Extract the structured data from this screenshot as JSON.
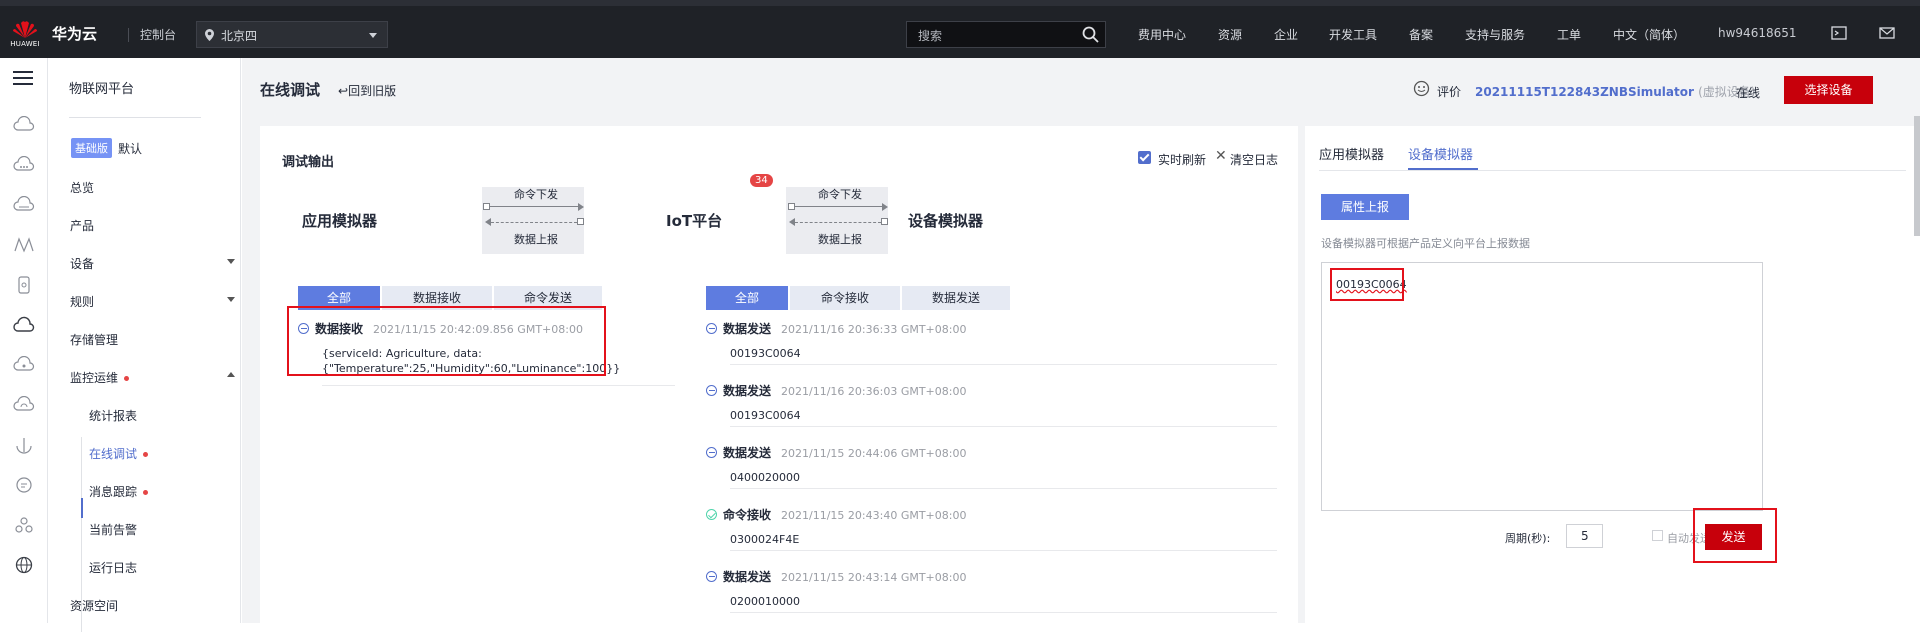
{
  "topbar": {
    "logo_small": "HUAWEI",
    "brand": "华为云",
    "console": "控制台",
    "region": "北京四",
    "search_placeholder": "搜索",
    "nav": [
      "费用中心",
      "资源",
      "企业",
      "开发工具",
      "备案",
      "支持与服务",
      "工单",
      "中文（简体）",
      "hw94618651"
    ]
  },
  "sidebar": {
    "title": "物联网平台",
    "edition_badge": "基础版",
    "edition_default": "默认",
    "items": [
      {
        "label": "总览"
      },
      {
        "label": "产品"
      },
      {
        "label": "设备"
      },
      {
        "label": "规则"
      },
      {
        "label": "存储管理"
      },
      {
        "label": "监控运维"
      }
    ],
    "subitems": [
      {
        "label": "统计报表"
      },
      {
        "label": "在线调试"
      },
      {
        "label": "消息跟踪"
      },
      {
        "label": "当前告警"
      },
      {
        "label": "运行日志"
      }
    ],
    "bottom_item": "资源空间"
  },
  "page": {
    "title": "在线调试",
    "back_link": "回到旧版",
    "rate": "评价",
    "device_name": "20211115T122843ZNBSimulator",
    "device_tag": "(虚拟设备)",
    "status": "在线",
    "select_device": "选择设备"
  },
  "debug": {
    "title": "调试输出",
    "realtime": "实时刷新",
    "clear": "清空日志",
    "flow": {
      "app": "应用模拟器",
      "iot": "IoT平台",
      "device": "设备模拟器",
      "cmd_down": "命令下发",
      "data_up": "数据上报",
      "badge": "34"
    },
    "left_tabs": [
      "全部",
      "数据接收",
      "命令发送"
    ],
    "right_tabs": [
      "全部",
      "命令接收",
      "数据发送"
    ],
    "left_logs": [
      {
        "type": "数据接收",
        "time": "2021/11/15 20:42:09.856 GMT+08:00",
        "line1": "{serviceId: Agriculture, data:",
        "line2": "{\"Temperature\":25,\"Humidity\":60,\"Luminance\":100}}"
      }
    ],
    "right_logs": [
      {
        "type": "数据发送",
        "time": "2021/11/16 20:36:33 GMT+08:00",
        "payload": "00193C0064"
      },
      {
        "type": "数据发送",
        "time": "2021/11/16 20:36:03 GMT+08:00",
        "payload": "00193C0064"
      },
      {
        "type": "数据发送",
        "time": "2021/11/15 20:44:06 GMT+08:00",
        "payload": "0400020000"
      },
      {
        "type": "命令接收",
        "time": "2021/11/15 20:43:40 GMT+08:00",
        "payload": "0300024F4E"
      },
      {
        "type": "数据发送",
        "time": "2021/11/15 20:43:14 GMT+08:00",
        "payload": "0200010000"
      }
    ]
  },
  "simulator": {
    "tab_app": "应用模拟器",
    "tab_device": "设备模拟器",
    "prop_report": "属性上报",
    "hint": "设备模拟器可根据产品定义向平台上报数据",
    "textarea_value": "00193C0064",
    "period_label": "周期(秒):",
    "period_value": "5",
    "auto_send": "自动发送",
    "send": "发送"
  },
  "colors": {
    "accent": "#526ecc",
    "brand_red": "#c7000b",
    "highlight_red": "#e3111b",
    "topbar": "#1f2227"
  }
}
